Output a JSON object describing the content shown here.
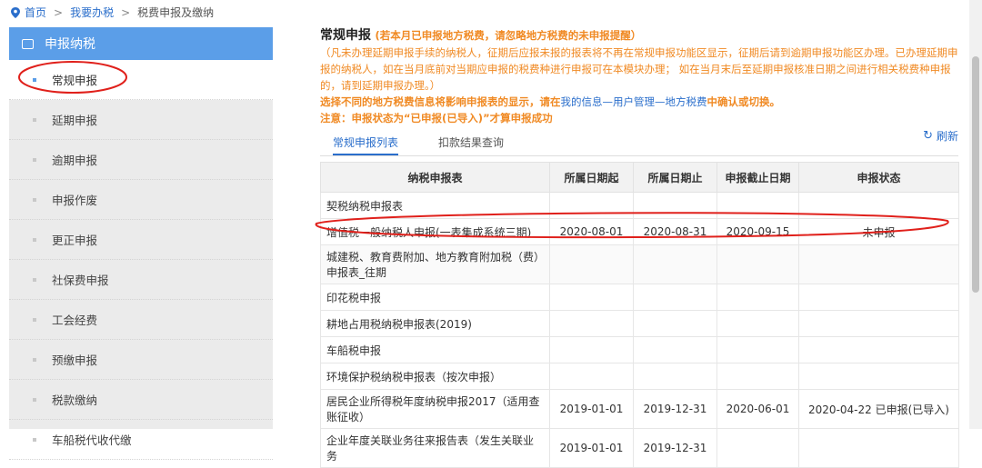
{
  "breadcrumb": {
    "home": "首页",
    "sep": ">",
    "level2": "我要办税",
    "level3": "税费申报及缴纳"
  },
  "sidebar": {
    "header": "申报纳税",
    "items": [
      {
        "label": "常规申报"
      },
      {
        "label": "延期申报"
      },
      {
        "label": "逾期申报"
      },
      {
        "label": "申报作废"
      },
      {
        "label": "更正申报"
      },
      {
        "label": "社保费申报"
      },
      {
        "label": "工会经费"
      },
      {
        "label": "预缴申报"
      },
      {
        "label": "税款缴纳"
      },
      {
        "label": "车船税代收代缴"
      }
    ]
  },
  "main": {
    "title": "常规申报",
    "title_hint": "(若本月已申报地方税费，请忽略地方税费的未申报提醒）",
    "notice": "（凡未办理延期申报手续的纳税人，征期后应报未报的报表将不再在常规申报功能区显示，征期后请到逾期申报功能区办理。已办理延期申报的纳税人，如在当月底前对当期应申报的税费种进行申报可在本模块办理； 如在当月末后至延期申报核准日期之间进行相关税费种申报的，请到延期申报办理。）",
    "note1_a": "选择不同的地方税费信息将影响申报表的显示，请在",
    "note1_link": "我的信息—用户管理—地方税费",
    "note1_b": "中确认或切换。",
    "note2": "注意：申报状态为“已申报(已导入)”才算申报成功",
    "tabs": [
      "常规申报列表",
      "扣款结果查询"
    ],
    "refresh": "刷新",
    "colors": {
      "accent": "#2a6ecb",
      "warning": "#f08a24",
      "sidebar_header": "#5b9ee8",
      "annotation": "#e0201b"
    }
  },
  "table": {
    "headers": [
      "纳税申报表",
      "所属日期起",
      "所属日期止",
      "申报截止日期",
      "申报状态"
    ],
    "rows": [
      {
        "name": "契税纳税申报表",
        "from": "",
        "to": "",
        "deadline": "",
        "status": ""
      },
      {
        "name": "增值税一般纳税人申报(一表集成系统三期)",
        "from": "2020-08-01",
        "to": "2020-08-31",
        "deadline": "2020-09-15",
        "status": "未申报"
      },
      {
        "name": "城建税、教育费附加、地方教育附加税（费）申报表_往期",
        "from": "",
        "to": "",
        "deadline": "",
        "status": ""
      },
      {
        "name": "印花税申报",
        "from": "",
        "to": "",
        "deadline": "",
        "status": ""
      },
      {
        "name": "耕地占用税纳税申报表(2019)",
        "from": "",
        "to": "",
        "deadline": "",
        "status": ""
      },
      {
        "name": "车船税申报",
        "from": "",
        "to": "",
        "deadline": "",
        "status": ""
      },
      {
        "name": "环境保护税纳税申报表（按次申报）",
        "from": "",
        "to": "",
        "deadline": "",
        "status": ""
      },
      {
        "name": "居民企业所得税年度纳税申报2017（适用查账征收）",
        "from": "2019-01-01",
        "to": "2019-12-31",
        "deadline": "2020-06-01",
        "status": "2020-04-22 已申报(已导入)"
      },
      {
        "name": "企业年度关联业务往来报告表（发生关联业务",
        "from": "2019-01-01",
        "to": "2019-12-31",
        "deadline": "",
        "status": ""
      }
    ]
  }
}
